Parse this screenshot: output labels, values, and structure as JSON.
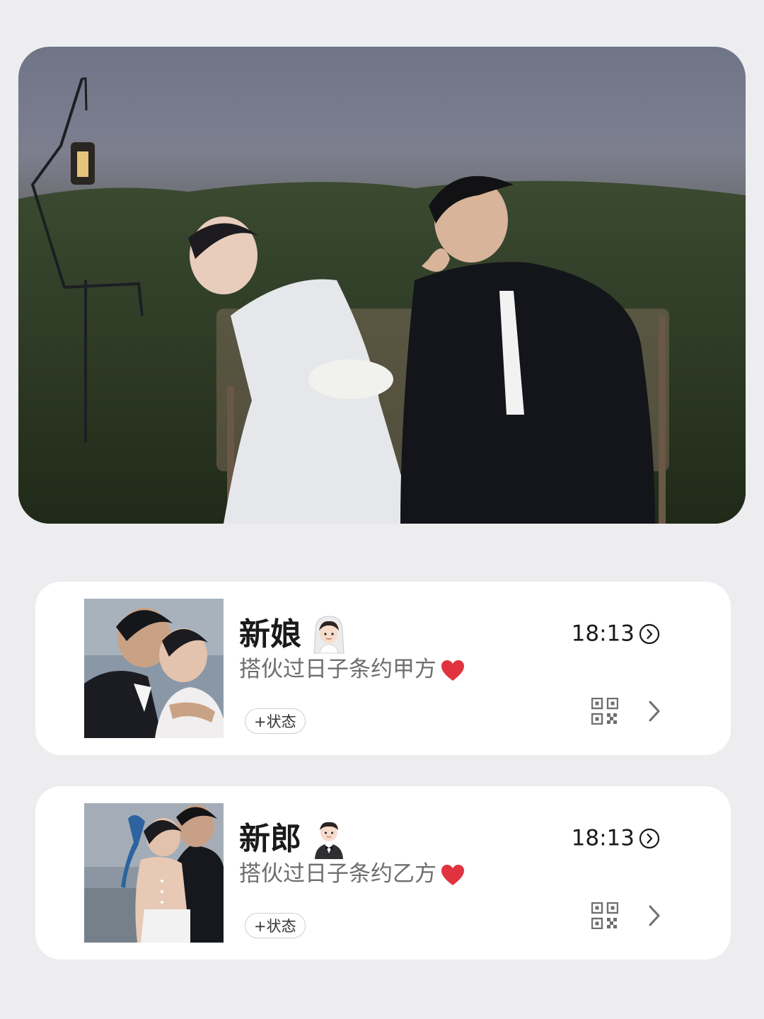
{
  "profiles": [
    {
      "name": "新娘",
      "name_emoji": "bride-with-veil-emoji-icon",
      "signature": "搭伙过日子条约甲方",
      "signature_emoji": "red-heart-icon",
      "time": "18:13",
      "status_button": "+状态"
    },
    {
      "name": "新郎",
      "name_emoji": "groom-in-tuxedo-emoji-icon",
      "signature": "搭伙过日子条约乙方",
      "signature_emoji": "red-heart-icon",
      "time": "18:13",
      "status_button": "+状态"
    }
  ],
  "colors": {
    "page_background": "#ededf0",
    "card_background": "#ffffff",
    "heart": "#e0323f",
    "primary_text": "#1a1a1a",
    "secondary_text": "#6e6e6e"
  }
}
